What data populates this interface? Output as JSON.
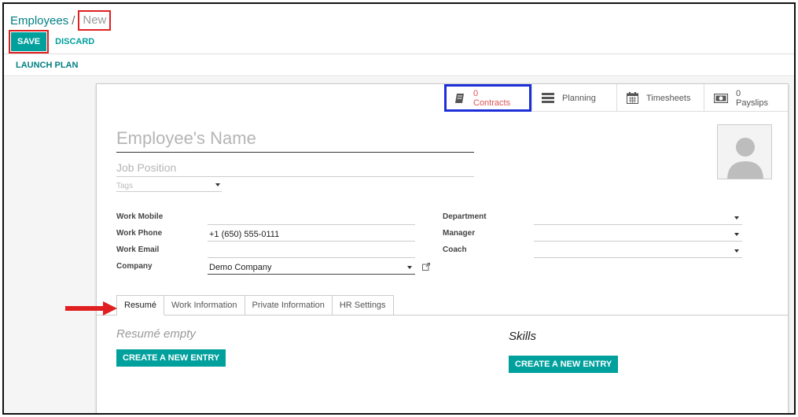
{
  "breadcrumb": {
    "parent": "Employees",
    "separator": "/",
    "current": "New"
  },
  "control_panel": {
    "save_label": "SAVE",
    "discard_label": "DISCARD"
  },
  "header": {
    "launch_plan_label": "LAUNCH PLAN"
  },
  "smart_buttons": {
    "contracts": {
      "count": "0",
      "label": "Contracts",
      "icon": "book-icon"
    },
    "planning": {
      "label": "Planning",
      "icon": "list-icon"
    },
    "timesheets": {
      "label": "Timesheets",
      "icon": "calendar-icon"
    },
    "payslips": {
      "count": "0",
      "label": "Payslips",
      "icon": "money-icon"
    }
  },
  "form": {
    "name_placeholder": "Employee's Name",
    "job_placeholder": "Job Position",
    "tags_placeholder": "Tags",
    "fields_left": [
      {
        "label": "Work Mobile",
        "value": ""
      },
      {
        "label": "Work Phone",
        "value": "+1 (650) 555-0111"
      },
      {
        "label": "Work Email",
        "value": ""
      },
      {
        "label": "Company",
        "value": "Demo Company"
      }
    ],
    "fields_right": [
      {
        "label": "Department",
        "value": ""
      },
      {
        "label": "Manager",
        "value": ""
      },
      {
        "label": "Coach",
        "value": ""
      }
    ]
  },
  "tabs": [
    {
      "label": "Resumé",
      "active": true
    },
    {
      "label": "Work Information",
      "active": false
    },
    {
      "label": "Private Information",
      "active": false
    },
    {
      "label": "HR Settings",
      "active": false
    }
  ],
  "resume": {
    "empty_text": "Resumé empty",
    "create_label": "CREATE A NEW ENTRY"
  },
  "skills": {
    "title": "Skills",
    "create_label": "CREATE A NEW ENTRY"
  },
  "colors": {
    "primary": "#00a09d",
    "link": "#017e84",
    "annotation_red": "#e02020",
    "annotation_blue": "#1d2fd8",
    "contracts_text": "#e05252"
  }
}
